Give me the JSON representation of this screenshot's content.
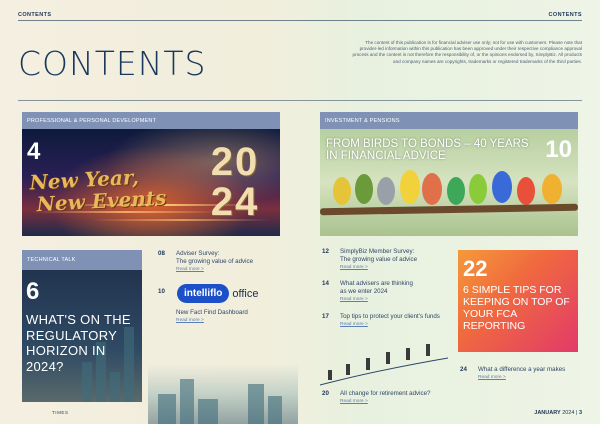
{
  "header": {
    "left": "CONTENTS",
    "right": "CONTENTS"
  },
  "title": "CONTENTS",
  "disclaimer": "The content of this publication is for financial adviser use only; not for use with customers. Please note that provider-led information within this publication has been approved under their respective compliance approval process and the content is not therefore the responsibility of, or the opinions endorsed by, SimplyBiz. All products and company names are copyrights, trademarks or registered trademarks of the third parties.",
  "panels": {
    "p1": {
      "tag": "PROFESSIONAL & PERSONAL DEVELOPMENT",
      "number": "4",
      "headline_line1": "New Year,",
      "headline_line2": "New Events",
      "year": "2024"
    },
    "p2": {
      "tag": "INVESTMENT & PENSIONS",
      "number": "10",
      "title": "FROM BIRDS TO BONDS – 40 YEARS IN FINANCIAL ADVICE"
    },
    "p3": {
      "tag": "TECHNICAL TALK",
      "number": "6",
      "title": "WHAT'S ON THE REGULATORY HORIZON IN 2024?"
    },
    "p4": {
      "number": "22",
      "title": "6 SIMPLE TIPS FOR KEEPING ON TOP OF YOUR FCA REPORTING"
    }
  },
  "items": [
    {
      "number": "08",
      "line1": "Adviser Survey:",
      "line2": "The growing value of advice",
      "more": "Read more >"
    },
    {
      "number": "10",
      "line1": "New Fact Find Dashboard",
      "line2": "",
      "more": "Read more >"
    },
    {
      "number": "12",
      "line1": "SimplyBiz Member Survey:",
      "line2": "The growing value of advice",
      "more": "Read more >"
    },
    {
      "number": "14",
      "line1": "What advisers are thinking",
      "line2": "as we enter 2024",
      "more": "Read more >"
    },
    {
      "number": "17",
      "line1": "Top tips to protect your client's funds",
      "line2": "",
      "more": "Read more >"
    },
    {
      "number": "20",
      "line1": "All change for retirement advice?",
      "line2": "",
      "more": "Read more >"
    },
    {
      "number": "24",
      "line1": "What a difference a year makes",
      "line2": "",
      "more": "Read more >"
    }
  ],
  "logo": {
    "pill": "intelliflo",
    "word": "office"
  },
  "footer": {
    "month": "JANUARY",
    "year": "2024",
    "page": "3",
    "left_fragment": "TIMES"
  },
  "icons": [
    "ribbon-arrow-icon"
  ]
}
